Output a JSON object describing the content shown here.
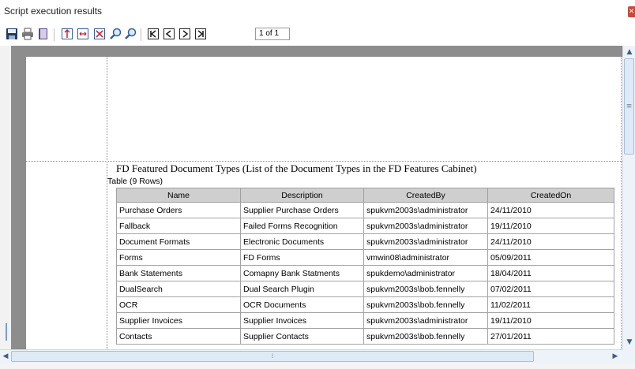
{
  "window": {
    "title": "Script execution results"
  },
  "toolbar": {
    "buttons": [
      "save",
      "print",
      "export",
      "first-group",
      "fit",
      "zoom-box",
      "zoom-in",
      "zoom-out",
      "first-page",
      "previous-page",
      "next-page",
      "last-page"
    ],
    "page_indicator": "1 of 1"
  },
  "report": {
    "title": "FD Featured Document Types (List of the Document Types in the FD Features Cabinet)",
    "row_count": "Table (9 Rows)",
    "columns": [
      "Name",
      "Description",
      "CreatedBy",
      "CreatedOn"
    ],
    "rows": [
      [
        "Purchase Orders",
        "Supplier Purchase Orders",
        "spukvm2003s\\administrator",
        "24/11/2010"
      ],
      [
        "Fallback",
        "Failed Forms Recognition",
        "spukvm2003s\\administrator",
        "19/11/2010"
      ],
      [
        "Document Formats",
        "Electronic Documents",
        "spukvm2003s\\administrator",
        "24/11/2010"
      ],
      [
        "Forms",
        "FD Forms",
        "vmwin08\\administrator",
        "05/09/2011"
      ],
      [
        "Bank Statements",
        "Comapny Bank Statments",
        "spukdemo\\administrator",
        "18/04/2011"
      ],
      [
        "DualSearch",
        "Dual Search Plugin",
        "spukvm2003s\\bob.fennelly",
        "07/02/2011"
      ],
      [
        "OCR",
        "OCR Documents",
        "spukvm2003s\\bob.fennelly",
        "11/02/2011"
      ],
      [
        "Supplier Invoices",
        "Supplier Invoices",
        "spukvm2003s\\administrator",
        "19/11/2010"
      ],
      [
        "Contacts",
        "Supplier Contacts",
        "spukvm2003s\\bob.fennelly",
        "27/01/2011"
      ]
    ]
  },
  "colors": {
    "viewport_bg": "#8d8d8d",
    "header_bg": "#cfcfcf",
    "scrollbar": "#dfeaf7",
    "close": "#c9483a"
  }
}
